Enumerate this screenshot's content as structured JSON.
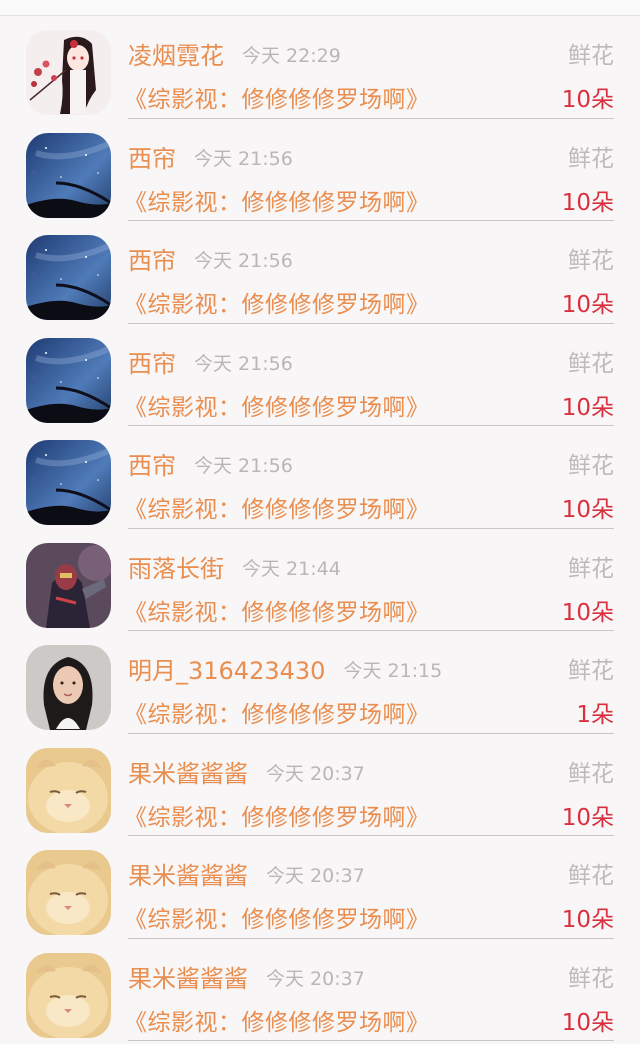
{
  "rows": [
    {
      "name": "凌烟霓花",
      "time": "今天 22:29",
      "gift": "鲜花",
      "work": "《综影视：修修修修罗场啊》",
      "count": "10朵",
      "avatar": "anime-girl"
    },
    {
      "name": "西帘",
      "time": "今天 21:56",
      "gift": "鲜花",
      "work": "《综影视：修修修修罗场啊》",
      "count": "10朵",
      "avatar": "starry-sky"
    },
    {
      "name": "西帘",
      "time": "今天 21:56",
      "gift": "鲜花",
      "work": "《综影视：修修修修罗场啊》",
      "count": "10朵",
      "avatar": "starry-sky"
    },
    {
      "name": "西帘",
      "time": "今天 21:56",
      "gift": "鲜花",
      "work": "《综影视：修修修修罗场啊》",
      "count": "10朵",
      "avatar": "starry-sky"
    },
    {
      "name": "西帘",
      "time": "今天 21:56",
      "gift": "鲜花",
      "work": "《综影视：修修修修罗场啊》",
      "count": "10朵",
      "avatar": "starry-sky"
    },
    {
      "name": "雨落长街",
      "time": "今天 21:44",
      "gift": "鲜花",
      "work": "《综影视：修修修修罗场啊》",
      "count": "10朵",
      "avatar": "hero-figure"
    },
    {
      "name": "明月_316423430",
      "time": "今天 21:15",
      "gift": "鲜花",
      "work": "《综影视：修修修修罗场啊》",
      "count": "1朵",
      "avatar": "woman-portrait"
    },
    {
      "name": "果米酱酱酱",
      "time": "今天 20:37",
      "gift": "鲜花",
      "work": "《综影视：修修修修罗场啊》",
      "count": "10朵",
      "avatar": "kitten"
    },
    {
      "name": "果米酱酱酱",
      "time": "今天 20:37",
      "gift": "鲜花",
      "work": "《综影视：修修修修罗场啊》",
      "count": "10朵",
      "avatar": "kitten"
    },
    {
      "name": "果米酱酱酱",
      "time": "今天 20:37",
      "gift": "鲜花",
      "work": "《综影视：修修修修罗场啊》",
      "count": "10朵",
      "avatar": "kitten"
    }
  ],
  "colors": {
    "name": "#e98e4f",
    "time": "#b9b6b7",
    "count": "#d9303f",
    "background": "#f8f6f7"
  }
}
